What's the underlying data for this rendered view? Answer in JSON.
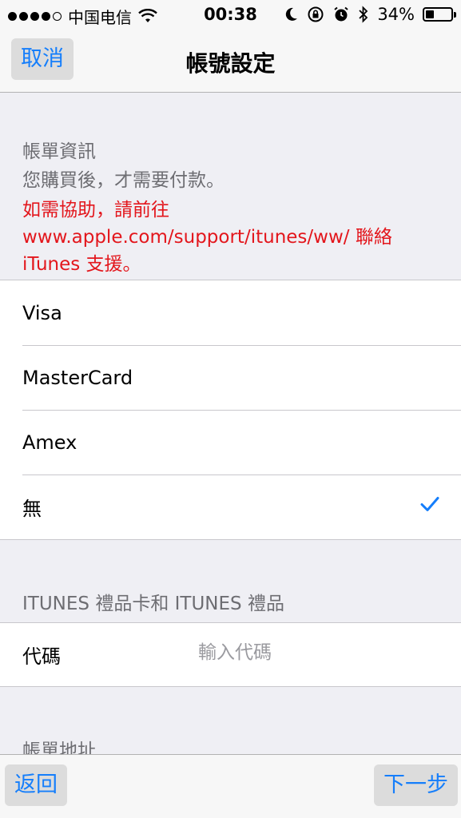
{
  "status_bar": {
    "carrier": "中国电信",
    "time": "00:38",
    "battery": "34%",
    "battery_level": 0.34,
    "signal_bars": 4
  },
  "nav": {
    "cancel_label": "取消",
    "title": "帳號設定"
  },
  "billing": {
    "header": "帳單資訊",
    "subtitle": "您購買後，才需要付款。",
    "help_line1": "如需協助，請前往",
    "help_line2": "www.apple.com/support/itunes/ww/ 聯絡",
    "help_line3": "iTunes 支援。"
  },
  "payment_options": [
    "Visa",
    "MasterCard",
    "Amex",
    "無"
  ],
  "selected_payment": "無",
  "itunes": {
    "header": "ITUNES 禮品卡和 ITUNES 禮品",
    "code_label": "代碼",
    "code_placeholder": "輸入代碼",
    "code_value": ""
  },
  "address": {
    "header": "帳單地址"
  },
  "toolbar": {
    "back_label": "返回",
    "next_label": "下一步"
  },
  "colors": {
    "accent": "#157efb",
    "help_red": "#e3161c",
    "secondary_text": "#6d6d72"
  },
  "icons": {
    "checkmark": "check-icon",
    "wifi": "wifi-icon",
    "moon": "moon-icon",
    "orientation_lock": "lock-rotation-icon",
    "alarm": "alarm-icon",
    "bluetooth": "bluetooth-icon",
    "battery": "battery-icon"
  }
}
